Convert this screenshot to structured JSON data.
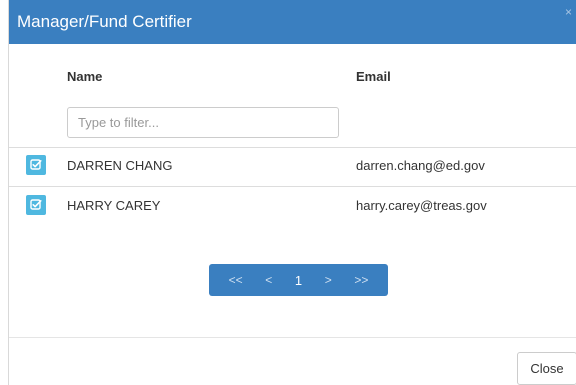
{
  "dialog": {
    "title": "Manager/Fund Certifier",
    "close_glyph": "×"
  },
  "table": {
    "columns": [
      "Name",
      "Email"
    ],
    "filter_placeholder": "Type to filter...",
    "rows": [
      {
        "name": "DARREN CHANG",
        "email": "darren.chang@ed.gov",
        "icon": "check-square-icon"
      },
      {
        "name": "HARRY CAREY",
        "email": "harry.carey@treas.gov",
        "icon": "check-square-icon"
      }
    ]
  },
  "pagination": {
    "first": "<<",
    "prev": "<",
    "current": "1",
    "next": ">",
    "last": ">>"
  },
  "footer": {
    "close_label": "Close"
  },
  "colors": {
    "header_bg": "#3a7fc0",
    "select_btn": "#4fb8e0",
    "pager_bg": "#3a7fc0"
  }
}
